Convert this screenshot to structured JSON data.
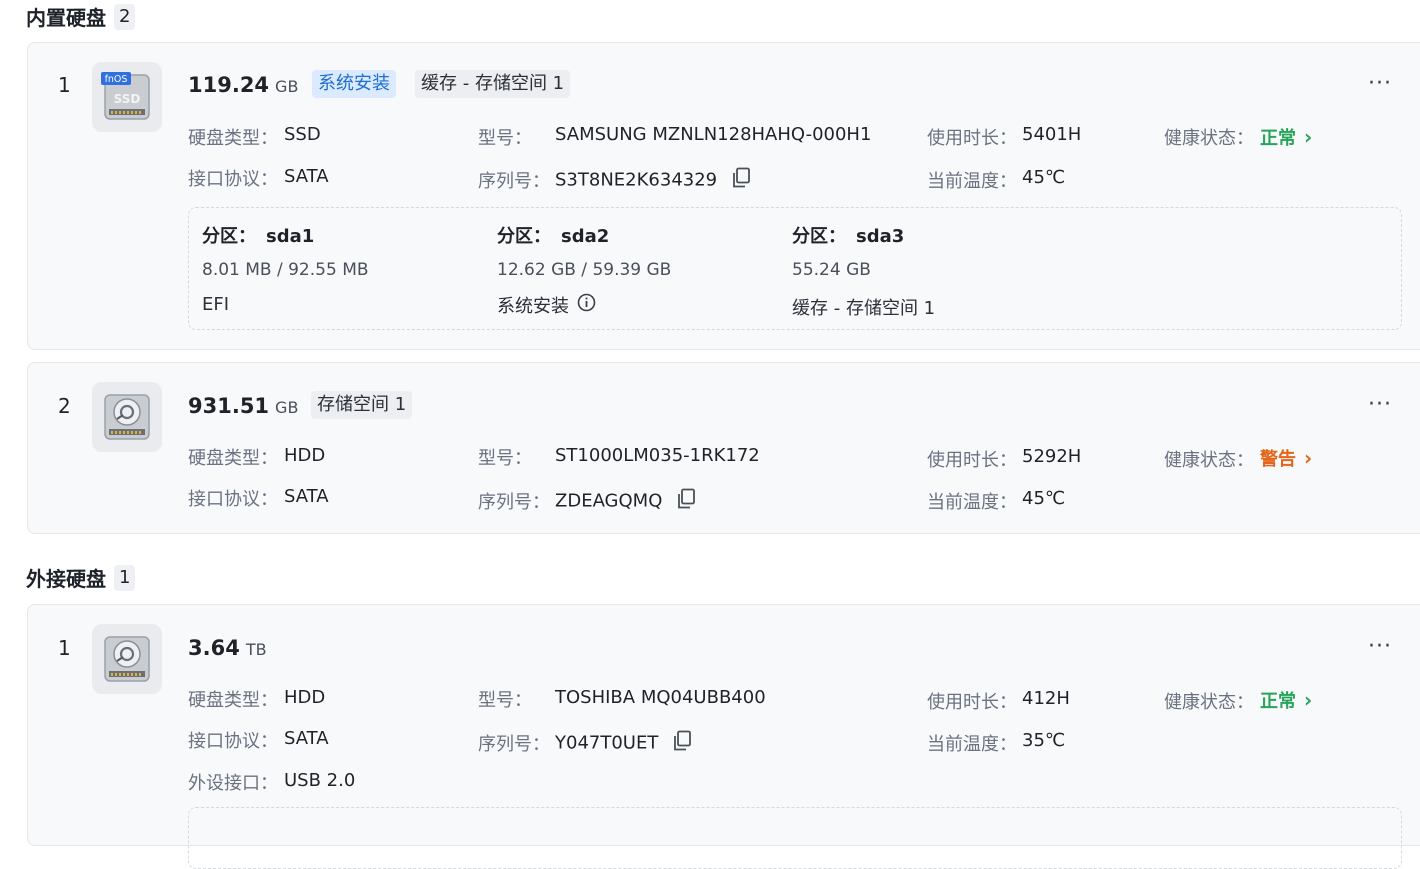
{
  "sections": {
    "internal": {
      "title": "内置硬盘",
      "count": "2"
    },
    "external": {
      "title": "外接硬盘",
      "count": "1"
    }
  },
  "labels": {
    "type": "硬盘类型：",
    "model": "型号：",
    "uptime": "使用时长：",
    "health": "健康状态：",
    "interface": "接口协议：",
    "serial": "序列号：",
    "temp": "当前温度：",
    "ext_port": "外设接口：",
    "partition": "分区：",
    "more": "···"
  },
  "disks": [
    {
      "index": "1",
      "icon_badge": "fnOS",
      "icon_text": "SSD",
      "capacity": "119.24",
      "unit": "GB",
      "tags": [
        "系统安装",
        "缓存 - 存储空间 1"
      ],
      "type": "SSD",
      "model": "SAMSUNG MZNLN128HAHQ-000H1",
      "uptime": "5401H",
      "health": "正常",
      "interface": "SATA",
      "serial": "S3T8NE2K634329",
      "temp": "45℃",
      "partitions": [
        {
          "name": "sda1",
          "size": "8.01 MB / 92.55 MB",
          "usage": "EFI"
        },
        {
          "name": "sda2",
          "size": "12.62 GB / 59.39 GB",
          "usage": "系统安装"
        },
        {
          "name": "sda3",
          "size": "55.24 GB",
          "usage": "缓存 - 存储空间 1"
        }
      ]
    },
    {
      "index": "2",
      "capacity": "931.51",
      "unit": "GB",
      "tags": [
        "存储空间 1"
      ],
      "type": "HDD",
      "model": "ST1000LM035-1RK172",
      "uptime": "5292H",
      "health": "警告",
      "interface": "SATA",
      "serial": "ZDEAGQMQ",
      "temp": "45℃"
    }
  ],
  "external_disks": [
    {
      "index": "1",
      "capacity": "3.64",
      "unit": "TB",
      "type": "HDD",
      "model": "TOSHIBA MQ04UBB400",
      "uptime": "412H",
      "health": "正常",
      "interface": "SATA",
      "serial": "Y047T0UET",
      "temp": "35℃",
      "ext_port": "USB 2.0"
    }
  ],
  "colors": {
    "ok": "#27a35a",
    "warn": "#e4661a",
    "tag_blue": "#1f6fd1"
  }
}
